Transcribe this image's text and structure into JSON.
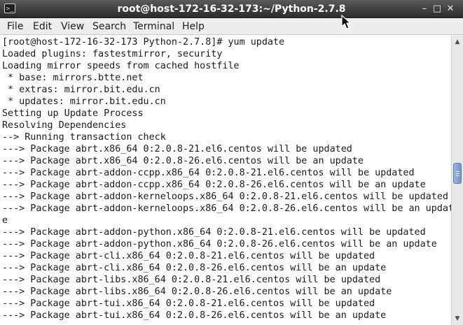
{
  "window": {
    "title": "root@host-172-16-32-173:~/Python-2.7.8",
    "app_icon": "terminal-icon",
    "controls": {
      "minimize": "–",
      "maximize": "□",
      "close": "✕"
    }
  },
  "menubar": {
    "items": [
      {
        "label": "File"
      },
      {
        "label": "Edit"
      },
      {
        "label": "View"
      },
      {
        "label": "Search"
      },
      {
        "label": "Terminal"
      },
      {
        "label": "Help"
      }
    ]
  },
  "terminal": {
    "lines": [
      "[root@host-172-16-32-173 Python-2.7.8]# yum update",
      "Loaded plugins: fastestmirror, security",
      "Loading mirror speeds from cached hostfile",
      " * base: mirrors.btte.net",
      " * extras: mirror.bit.edu.cn",
      " * updates: mirror.bit.edu.cn",
      "Setting up Update Process",
      "Resolving Dependencies",
      "--> Running transaction check",
      "---> Package abrt.x86_64 0:2.0.8-21.el6.centos will be updated",
      "---> Package abrt.x86_64 0:2.0.8-26.el6.centos will be an update",
      "---> Package abrt-addon-ccpp.x86_64 0:2.0.8-21.el6.centos will be updated",
      "---> Package abrt-addon-ccpp.x86_64 0:2.0.8-26.el6.centos will be an update",
      "---> Package abrt-addon-kerneloops.x86_64 0:2.0.8-21.el6.centos will be updated",
      "---> Package abrt-addon-kerneloops.x86_64 0:2.0.8-26.el6.centos will be an updat",
      "e",
      "---> Package abrt-addon-python.x86_64 0:2.0.8-21.el6.centos will be updated",
      "---> Package abrt-addon-python.x86_64 0:2.0.8-26.el6.centos will be an update",
      "---> Package abrt-cli.x86_64 0:2.0.8-21.el6.centos will be updated",
      "---> Package abrt-cli.x86_64 0:2.0.8-26.el6.centos will be an update",
      "---> Package abrt-libs.x86_64 0:2.0.8-21.el6.centos will be updated",
      "---> Package abrt-libs.x86_64 0:2.0.8-26.el6.centos will be an update",
      "---> Package abrt-tui.x86_64 0:2.0.8-21.el6.centos will be updated",
      "---> Package abrt-tui.x86_64 0:2.0.8-26.el6.centos will be an update"
    ]
  },
  "scrollbar": {
    "up_arrow": "▲",
    "down_arrow": "▼"
  }
}
